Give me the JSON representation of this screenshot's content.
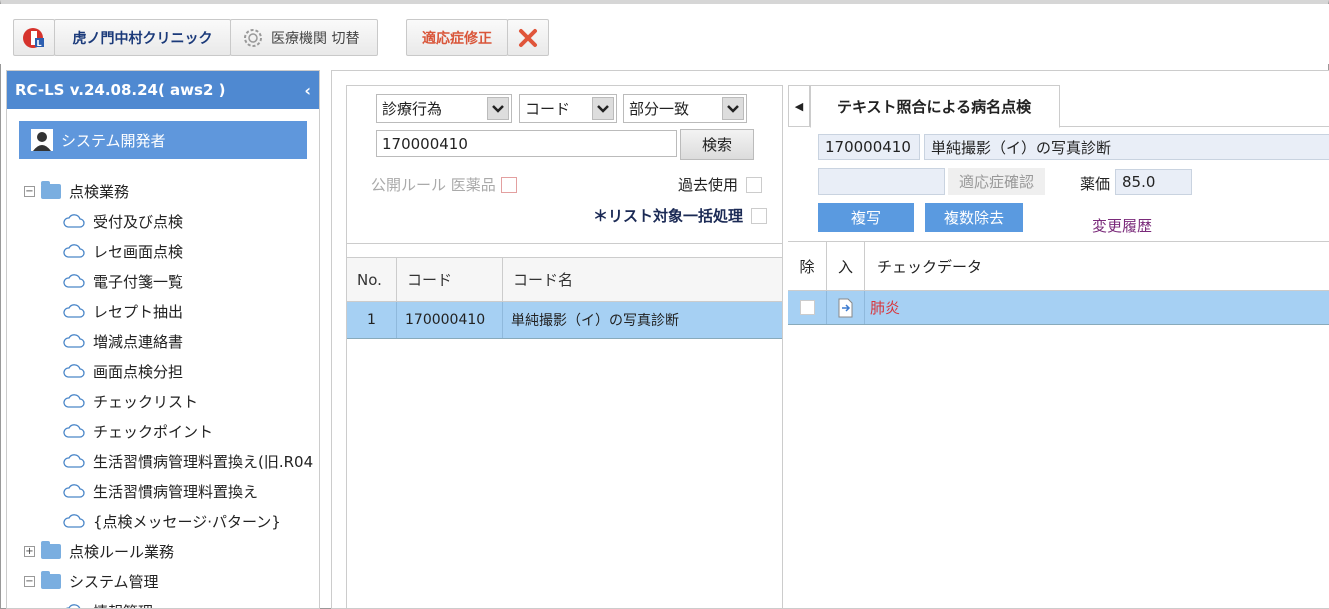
{
  "toolbar": {
    "clinic_name": "虎ノ門中村クリニック",
    "switch_label": "医療機関 切替",
    "fix_label": "適応症修正"
  },
  "sidebar": {
    "version": "RC-LS v.24.08.24( aws2 )",
    "user": "システム開発者",
    "tree": [
      {
        "type": "folder",
        "open": true,
        "label": "点検業務"
      },
      {
        "type": "leaf",
        "label": "受付及び点検"
      },
      {
        "type": "leaf",
        "label": "レセ画面点検"
      },
      {
        "type": "leaf",
        "label": "電子付箋一覧"
      },
      {
        "type": "leaf",
        "label": "レセプト抽出"
      },
      {
        "type": "leaf",
        "label": "増減点連絡書"
      },
      {
        "type": "leaf",
        "label": "画面点検分担"
      },
      {
        "type": "leaf",
        "label": "チェックリスト"
      },
      {
        "type": "leaf",
        "label": "チェックポイント"
      },
      {
        "type": "leaf",
        "label": "生活習慣病管理料置換え(旧.R04"
      },
      {
        "type": "leaf",
        "label": "生活習慣病管理料置換え"
      },
      {
        "type": "leaf",
        "label": "{点検メッセージ·パターン}"
      },
      {
        "type": "folder",
        "open": false,
        "label": "点検ルール業務"
      },
      {
        "type": "folder",
        "open": true,
        "label": "システム管理"
      },
      {
        "type": "leaf",
        "label": "情報管理"
      }
    ]
  },
  "search": {
    "select1": "診療行為",
    "select2": "コード",
    "select3": "部分一致",
    "code_value": "170000410",
    "search_button": "検索",
    "public_rule": "公開ルール 医薬品",
    "past_use": "過去使用",
    "bulk_process": "＊リスト対象一括処理"
  },
  "result_table": {
    "headers": [
      "No.",
      "コード",
      "コード名"
    ],
    "rows": [
      {
        "no": "1",
        "code": "170000410",
        "name": "単純撮影（イ）の写真診断"
      }
    ]
  },
  "detail": {
    "tab_label": "テキスト照合による病名点検",
    "code": "170000410",
    "name": "単純撮影（イ）の写真診断",
    "indication_confirm": "適応症確認",
    "price_label": "薬価",
    "price_value": "85.0",
    "copy_button": "複写",
    "multi_remove_button": "複数除去",
    "history_link": "変更履歴",
    "check_headers": [
      "除",
      "入",
      "チェックデータ"
    ],
    "check_rows": [
      {
        "data": "肺炎"
      }
    ]
  },
  "colors": {
    "accent_blue": "#4f89d1",
    "row_highlight": "#a6d0f3",
    "warning_red": "#d9563a",
    "check_text_red": "#d9343a"
  }
}
